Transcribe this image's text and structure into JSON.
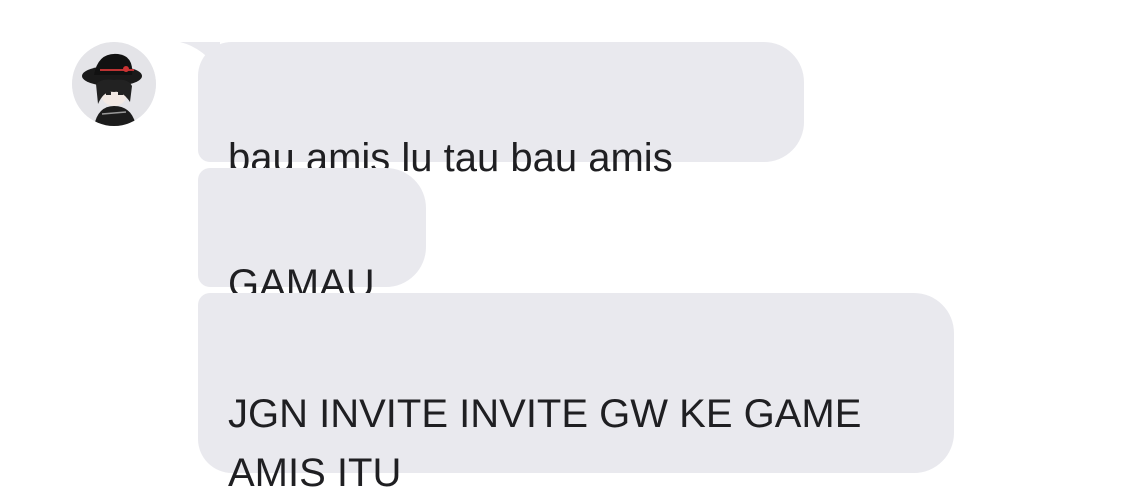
{
  "conversation": {
    "sender": {
      "avatar_icon": "user-avatar-icon"
    },
    "messages": [
      {
        "text": "bau amis lu tau bau amis"
      },
      {
        "text": "GAMAU"
      },
      {
        "text": "JGN INVITE INVITE GW KE GAME\nAMIS ITU"
      }
    ]
  },
  "colors": {
    "bubble_bg": "#e9e9ee",
    "text": "#1f1f22",
    "background": "#ffffff"
  }
}
